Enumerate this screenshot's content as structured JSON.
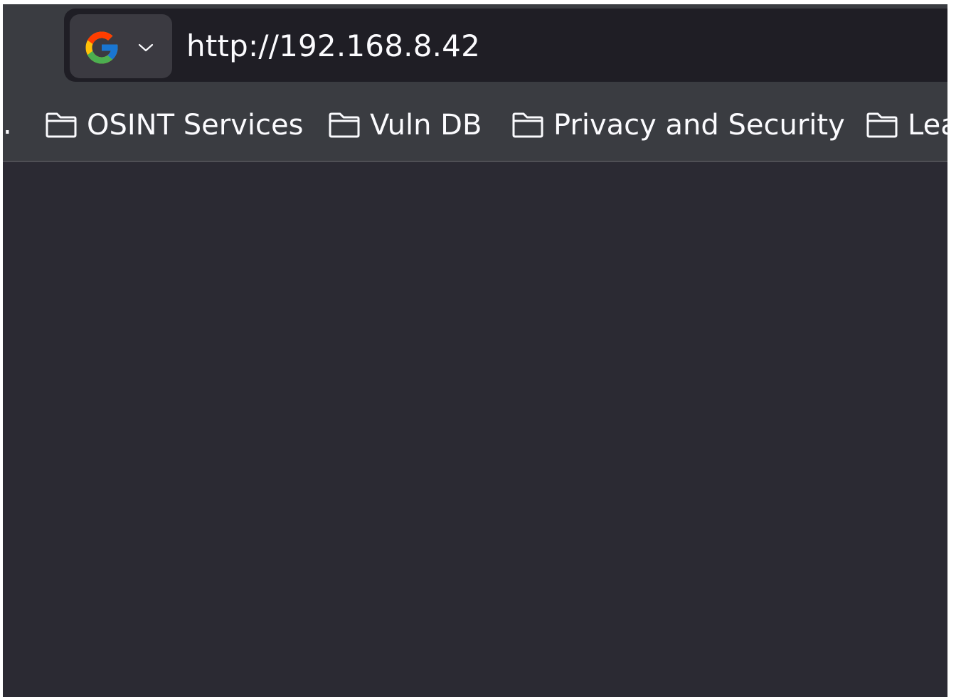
{
  "url_bar": {
    "url": "http://192.168.8.42",
    "search_engine_icon": "google-icon",
    "engine_menu_icon": "chevron-down-icon"
  },
  "bookmarks": {
    "overflow_text": ".",
    "items": [
      {
        "label": "OSINT Services",
        "icon": "folder-icon"
      },
      {
        "label": "Vuln DB",
        "icon": "folder-icon"
      },
      {
        "label": "Privacy and Security",
        "icon": "folder-icon"
      },
      {
        "label": "Lea",
        "icon": "folder-icon"
      }
    ]
  },
  "colors": {
    "toolbar_bg": "#3a3c41",
    "urlbar_bg": "#1f1e25",
    "content_bg": "#2b2a33",
    "text": "#fbfbfe"
  }
}
